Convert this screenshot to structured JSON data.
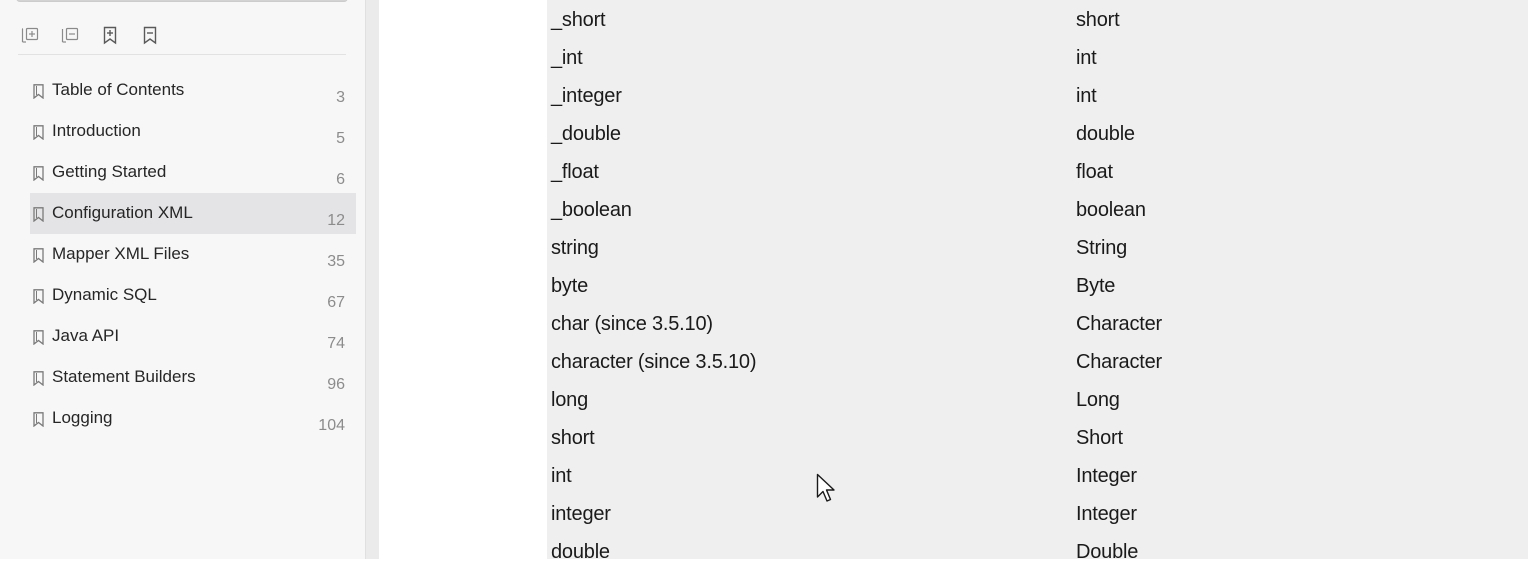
{
  "sidebar": {
    "toolbar": [
      {
        "icon": "expand-all-icon"
      },
      {
        "icon": "collapse-all-icon"
      },
      {
        "icon": "add-bookmark-icon"
      },
      {
        "icon": "remove-bookmark-icon"
      }
    ],
    "bookmarks": [
      {
        "title": "Table of Contents",
        "page": "3"
      },
      {
        "title": "Introduction",
        "page": "5"
      },
      {
        "title": "Getting Started",
        "page": "6"
      },
      {
        "title": "Configuration XML",
        "page": "12",
        "selected": true
      },
      {
        "title": "Mapper XML Files",
        "page": "35"
      },
      {
        "title": "Dynamic SQL",
        "page": "67"
      },
      {
        "title": "Java API",
        "page": "74"
      },
      {
        "title": "Statement Builders",
        "page": "96"
      },
      {
        "title": "Logging",
        "page": "104"
      }
    ]
  },
  "table": {
    "rows": [
      {
        "alias": "_short",
        "type": "short"
      },
      {
        "alias": "_int",
        "type": "int"
      },
      {
        "alias": "_integer",
        "type": "int"
      },
      {
        "alias": "_double",
        "type": "double"
      },
      {
        "alias": "_float",
        "type": "float"
      },
      {
        "alias": "_boolean",
        "type": "boolean"
      },
      {
        "alias": "string",
        "type": "String"
      },
      {
        "alias": "byte",
        "type": "Byte"
      },
      {
        "alias": "char (since 3.5.10)",
        "type": "Character"
      },
      {
        "alias": "character (since 3.5.10)",
        "type": "Character"
      },
      {
        "alias": "long",
        "type": "Long"
      },
      {
        "alias": "short",
        "type": "Short"
      },
      {
        "alias": "int",
        "type": "Integer"
      },
      {
        "alias": "integer",
        "type": "Integer"
      },
      {
        "alias": "double",
        "type": "Double"
      }
    ]
  },
  "colors": {
    "sidebar_bg": "#f7f7f7",
    "selected_bg": "#e4e4e7",
    "table_bg": "#efefef"
  }
}
